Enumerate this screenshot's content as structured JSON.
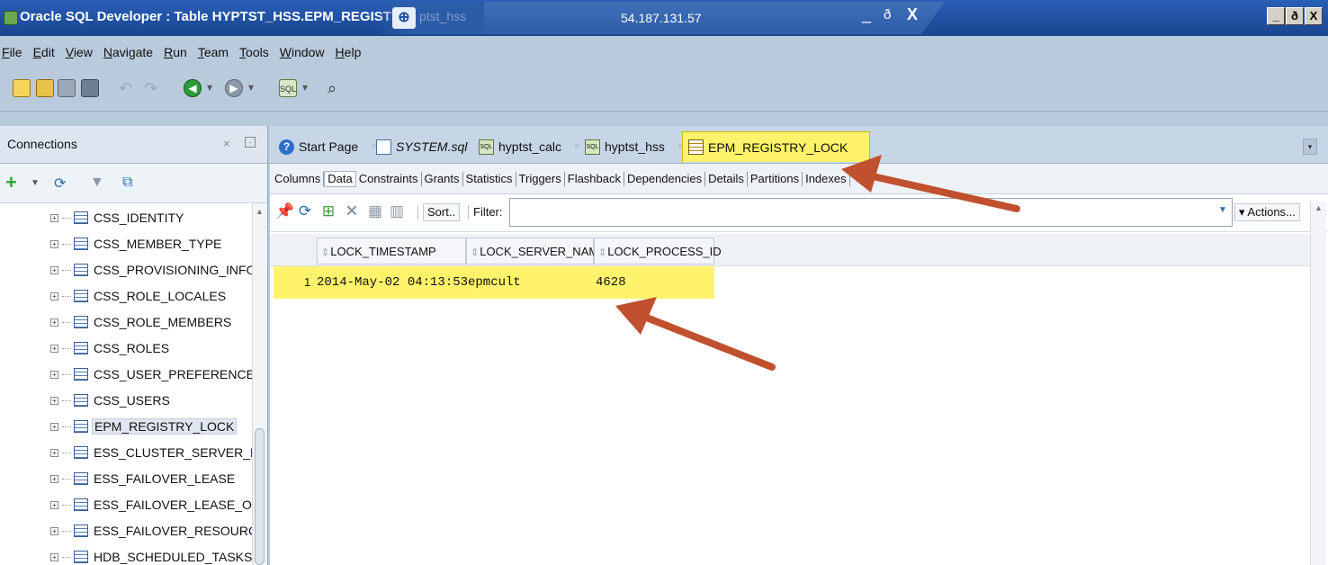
{
  "window": {
    "title": "Oracle SQL Developer : Table HYPTST_HSS.EPM_REGISTRY_LO",
    "faded_title": "ptst_hss",
    "remote_ip": "54.187.131.57",
    "remote_min": "_",
    "remote_restore": "ð",
    "remote_close": "X",
    "controls": [
      "_",
      "ð",
      "X"
    ]
  },
  "menu": [
    "File",
    "Edit",
    "View",
    "Navigate",
    "Run",
    "Team",
    "Tools",
    "Window",
    "Help"
  ],
  "connections": {
    "title": "Connections",
    "min_label": "×",
    "max_label": "-",
    "tree": [
      "CSS_IDENTITY",
      "CSS_MEMBER_TYPE",
      "CSS_PROVISIONING_INFO",
      "CSS_ROLE_LOCALES",
      "CSS_ROLE_MEMBERS",
      "CSS_ROLES",
      "CSS_USER_PREFERENCES",
      "CSS_USERS",
      "EPM_REGISTRY_LOCK",
      "ESS_CLUSTER_SERVER_MAPPIN",
      "ESS_FAILOVER_LEASE",
      "ESS_FAILOVER_LEASE_OWNER",
      "ESS_FAILOVER_RESOURCE",
      "HDB_SCHEDULED_TASKS"
    ],
    "selected": "EPM_REGISTRY_LOCK"
  },
  "tabs": [
    {
      "label": "Start Page",
      "icon": "help-icon"
    },
    {
      "label": "SYSTEM.sql",
      "icon": "sql-file-icon"
    },
    {
      "label": "hyptst_calc",
      "icon": "db-connection-icon"
    },
    {
      "label": "hyptst_hss",
      "icon": "db-connection-icon"
    },
    {
      "label": "EPM_REGISTRY_LOCK",
      "icon": "table-icon"
    }
  ],
  "subtabs": [
    "Columns",
    "Data",
    "Constraints",
    "Grants",
    "Statistics",
    "Triggers",
    "Flashback",
    "Dependencies",
    "Details",
    "Partitions",
    "Indexes"
  ],
  "current_subtab": "Data",
  "data_toolbar": {
    "sort_label": "Sort..",
    "filter_label": "Filter:",
    "filter_value": "",
    "actions_label": "▾ Actions..."
  },
  "grid": {
    "columns": [
      "LOCK_TIMESTAMP",
      "LOCK_SERVER_NAME",
      "LOCK_PROCESS_ID"
    ],
    "rows": [
      {
        "num": "1",
        "cells": [
          "2014-May-02 04:13:53",
          "epmcult",
          "4628"
        ]
      }
    ]
  },
  "colors": {
    "highlight": "#fff36b",
    "arrow": "#c0502e",
    "titlebar": "#1f4f9f"
  }
}
